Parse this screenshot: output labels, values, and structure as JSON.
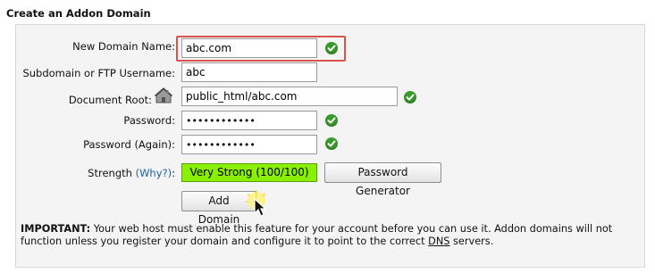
{
  "section_title": "Create an Addon Domain",
  "form": {
    "domain_label": "New Domain Name:",
    "domain_value": "abc.com",
    "subdomain_label": "Subdomain or FTP Username:",
    "subdomain_value": "abc",
    "docroot_label": "Document Root:",
    "docroot_value": "public_html/abc.com",
    "password_label": "Password:",
    "password_value": "••••••••••••",
    "password_again_label": "Password (Again):",
    "password_again_value": "••••••••••••",
    "strength_label": "Strength",
    "why_link": "(Why?)",
    "strength_suffix": ":",
    "strength_value": "Very Strong (100/100)",
    "password_generator_button": "Password Generator",
    "add_domain_button": "Add Domain"
  },
  "notice": {
    "important_label": "IMPORTANT:",
    "text_before_dns": " Your web host must enable this feature for your account before you can use it. Addon domains will not function unless you register your domain and configure it to point to the correct ",
    "dns": "DNS",
    "text_after_dns": " servers."
  },
  "colors": {
    "strength_bar": "#88f000",
    "highlight_border": "#d9534f",
    "check_icon": "#3a9a2e"
  },
  "icons": {
    "field_valid": "green-check-icon",
    "document_root": "home-folder-icon",
    "cursor": "pointer-cursor-icon"
  }
}
